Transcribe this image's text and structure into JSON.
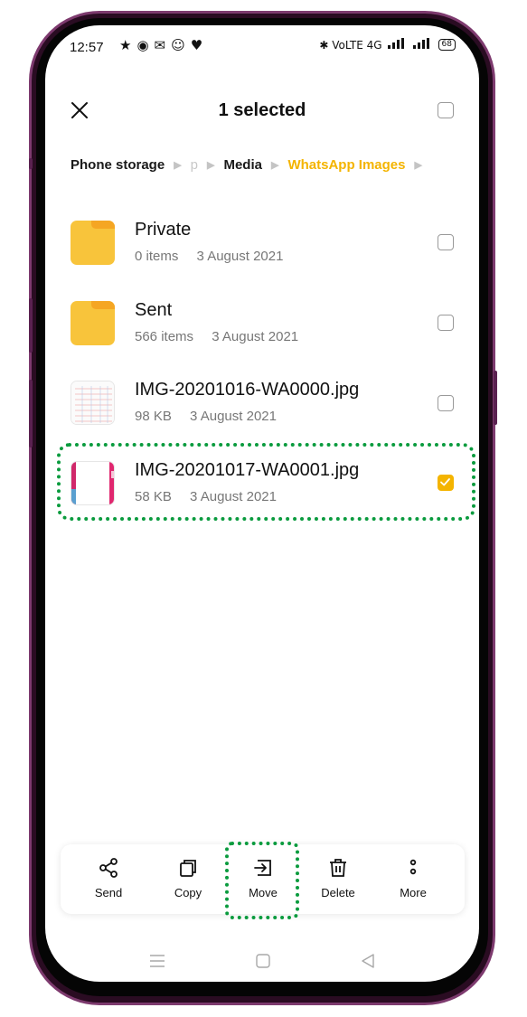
{
  "status_bar": {
    "time": "12:57",
    "left_icons": "★◉✉☺♥",
    "network": "✱ VoLTE 4G",
    "battery": "68"
  },
  "header": {
    "title": "1 selected"
  },
  "breadcrumb": {
    "items": [
      "Phone storage",
      "p",
      "Media",
      "WhatsApp Images"
    ]
  },
  "files": [
    {
      "name": "Private",
      "count": "0 items",
      "date": "3 August 2021",
      "type": "folder",
      "checked": false
    },
    {
      "name": "Sent",
      "count": "566 items",
      "date": "3 August 2021",
      "type": "folder",
      "checked": false
    },
    {
      "name": "IMG-20201016-WA0000.jpg",
      "count": "98 KB",
      "date": "3 August 2021",
      "type": "image",
      "checked": false
    },
    {
      "name": "IMG-20201017-WA0001.jpg",
      "count": "58 KB",
      "date": "3 August 2021",
      "type": "image",
      "checked": true
    }
  ],
  "toolbar": {
    "send": "Send",
    "copy": "Copy",
    "move": "Move",
    "delete": "Delete",
    "more": "More"
  },
  "colors": {
    "accent": "#f4b400",
    "highlight": "#0a9b3e",
    "folder": "#f8c43b"
  }
}
